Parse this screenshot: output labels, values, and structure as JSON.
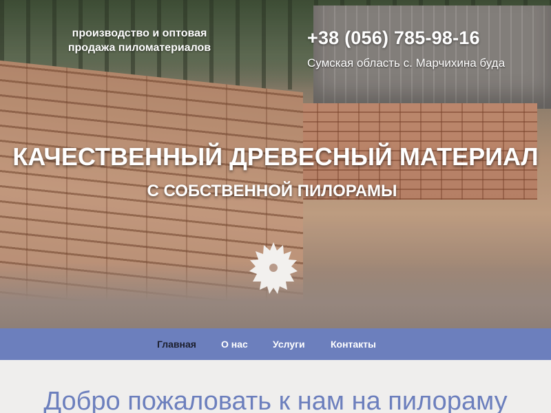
{
  "header": {
    "tagline_line1": "производство и оптовая",
    "tagline_line2": "продажа пиломатериалов",
    "phone": "+38 (056) 785-98-16",
    "address": "Сумская область с. Марчихина буда"
  },
  "hero": {
    "headline": "КАЧЕСТВЕННЫЙ ДРЕВЕСНЫЙ МАТЕРИАЛ",
    "subheadline": "С СОБСТВЕННОЙ ПИЛОРАМЫ",
    "icon": "saw-blade-icon"
  },
  "nav": {
    "items": [
      {
        "label": "Главная",
        "active": true
      },
      {
        "label": "О нас",
        "active": false
      },
      {
        "label": "Услуги",
        "active": false
      },
      {
        "label": "Контакты",
        "active": false
      }
    ]
  },
  "main": {
    "welcome": "Добро пожаловать к нам на пилораму"
  },
  "colors": {
    "nav_bg": "#6c7fbd",
    "nav_active_text": "#1c1f2e",
    "welcome_text": "#6c7fbd",
    "page_bg": "#efeeed"
  }
}
